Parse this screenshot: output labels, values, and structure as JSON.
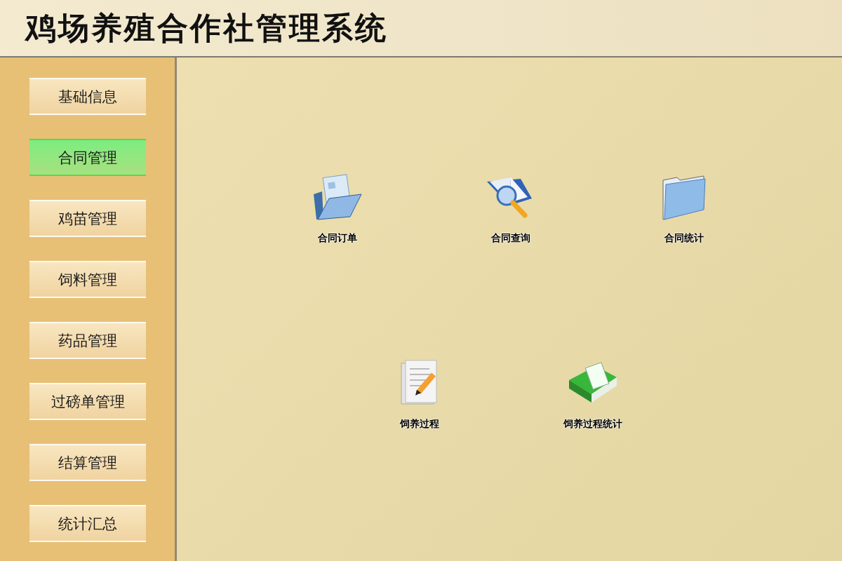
{
  "window": {
    "title": "鸡场养殖合作社管理系统"
  },
  "sidebar": {
    "items": [
      {
        "label": "基础信息",
        "selected": false
      },
      {
        "label": "合同管理",
        "selected": true
      },
      {
        "label": "鸡苗管理",
        "selected": false
      },
      {
        "label": "饲料管理",
        "selected": false
      },
      {
        "label": "药品管理",
        "selected": false
      },
      {
        "label": "过磅单管理",
        "selected": false
      },
      {
        "label": "结算管理",
        "selected": false
      },
      {
        "label": "统计汇总",
        "selected": false
      }
    ]
  },
  "shortcut_rows": [
    {
      "items": [
        {
          "label": "合同订单"
        },
        {
          "label": "合同查询"
        },
        {
          "label": "合同统计"
        }
      ]
    },
    {
      "items": [
        {
          "label": "饲养过程"
        },
        {
          "label": "饲养过程统计"
        }
      ]
    }
  ]
}
